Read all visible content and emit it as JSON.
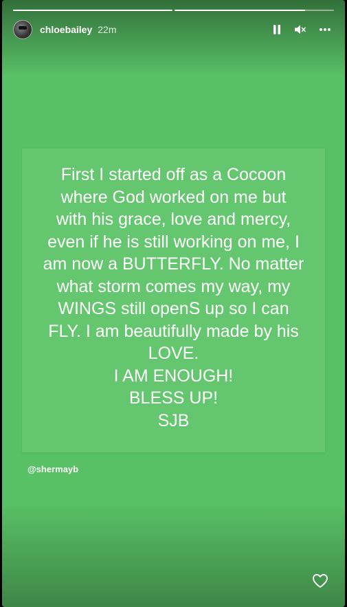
{
  "story": {
    "background_color": "#58c065",
    "progress": [
      1.0,
      0.82
    ]
  },
  "header": {
    "username": "chloebailey",
    "time": "22m",
    "icons": [
      "pause-icon",
      "mute-icon",
      "more-icon"
    ]
  },
  "card": {
    "lines": [
      "First I started off as a Cocoon",
      "where God worked on me but",
      "with his grace, love and mercy,",
      "even if he is still working on me, I",
      "am now a BUTTERFLY. No matter",
      "what storm comes my way, my",
      "WINGS still openS up so I can",
      "FLY. I am beautifully made by his",
      "LOVE.",
      "I AM ENOUGH!",
      "BLESS UP!",
      "SJB"
    ]
  },
  "mention": "@shermayb",
  "footer": {
    "icon": "heart-icon"
  }
}
